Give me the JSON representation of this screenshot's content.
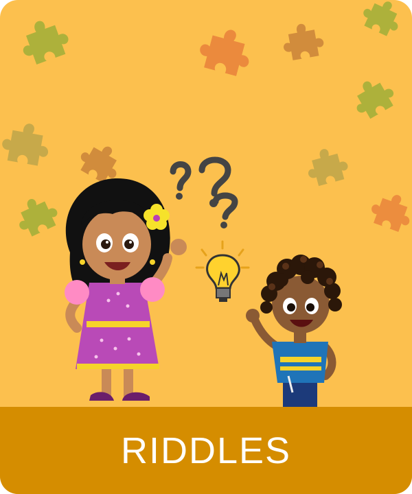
{
  "card": {
    "title": "RIDDLES",
    "background_color": "#fcc04e",
    "banner_color": "#d58d00",
    "title_color": "#ffffff"
  },
  "illustration": {
    "characters": [
      "girl-character",
      "boy-character"
    ],
    "decorations": [
      "puzzle-piece-icon",
      "question-mark-icon",
      "lightbulb-icon"
    ],
    "puzzle_colors": [
      "#9fae38",
      "#e07a3b",
      "#b38c3e"
    ]
  }
}
